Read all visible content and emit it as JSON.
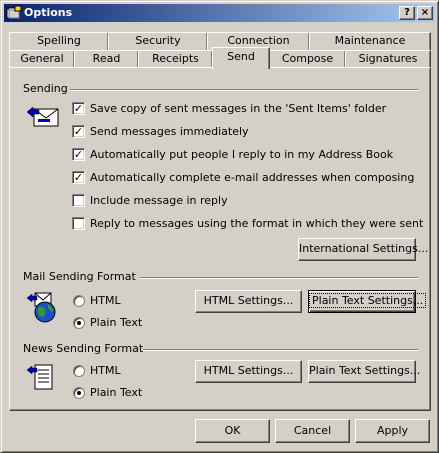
{
  "window": {
    "title": "Options",
    "help_button": "?",
    "close_button": "×"
  },
  "tabs_row1": [
    "Spelling",
    "Security",
    "Connection",
    "Maintenance"
  ],
  "tabs_row2": [
    "General",
    "Read",
    "Receipts",
    "Send",
    "Compose",
    "Signatures"
  ],
  "active_tab": "Send",
  "sending": {
    "title": "Sending",
    "options": [
      {
        "label": "Save copy of sent messages in the 'Sent Items' folder",
        "checked": true
      },
      {
        "label": "Send messages immediately",
        "checked": true
      },
      {
        "label": "Automatically put people I reply to in my Address Book",
        "checked": true
      },
      {
        "label": "Automatically complete e-mail addresses when composing",
        "checked": true
      },
      {
        "label": "Include message in reply",
        "checked": false
      },
      {
        "label": "Reply to messages using the format in which they were sent",
        "checked": false
      }
    ],
    "intl_button": "International Settings..."
  },
  "mail_format": {
    "title": "Mail Sending Format",
    "html_label": "HTML",
    "plain_label": "Plain Text",
    "selected": "Plain Text",
    "html_settings": "HTML Settings...",
    "plain_settings": "Plain Text Settings..."
  },
  "news_format": {
    "title": "News Sending Format",
    "html_label": "HTML",
    "plain_label": "Plain Text",
    "selected": "Plain Text",
    "html_settings": "HTML Settings...",
    "plain_settings": "Plain Text Settings..."
  },
  "footer": {
    "ok": "OK",
    "cancel": "Cancel",
    "apply": "Apply"
  },
  "colors": {
    "face": "#d4d0c8",
    "title_start": "#0a246a",
    "title_end": "#a6caf0"
  }
}
